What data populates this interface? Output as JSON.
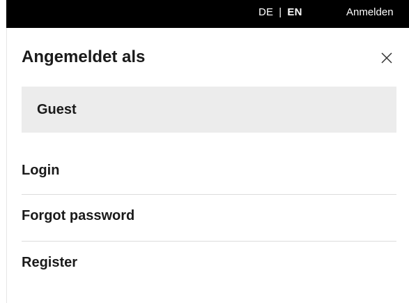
{
  "topbar": {
    "lang_de": "DE",
    "lang_separator": "|",
    "lang_en": "EN",
    "login_link": "Anmelden"
  },
  "panel": {
    "title": "Angemeldet als",
    "close_icon": "close-icon",
    "user": "Guest",
    "menu": [
      {
        "label": "Login"
      },
      {
        "label": "Forgot password"
      },
      {
        "label": "Register"
      }
    ]
  }
}
